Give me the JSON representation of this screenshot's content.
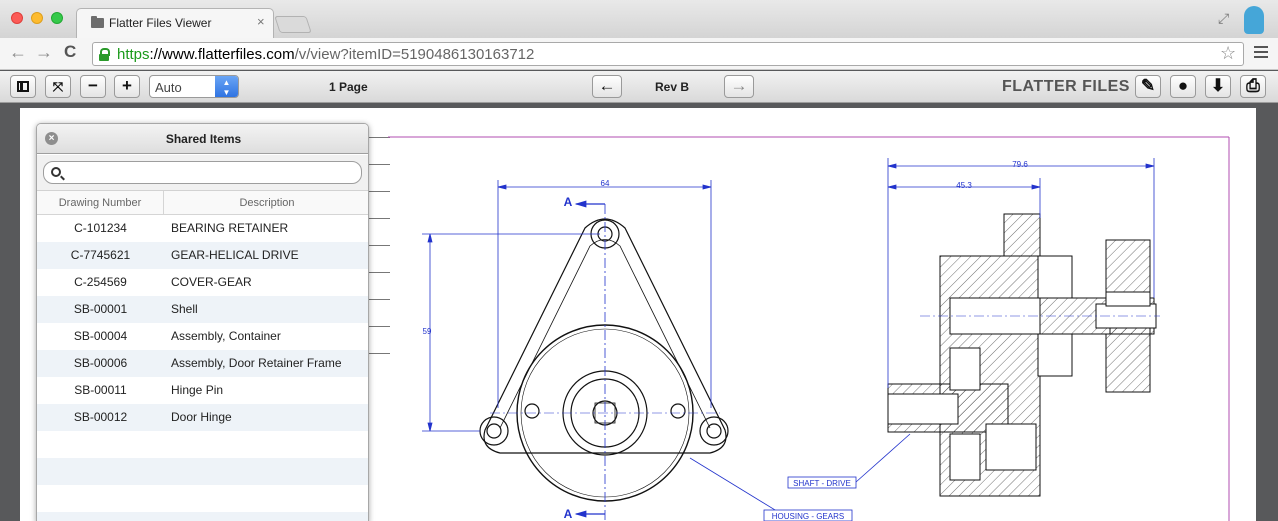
{
  "browser": {
    "tab_title": "Flatter Files Viewer",
    "tab_close": "×",
    "url_scheme": "https",
    "url_sep": "://",
    "url_host": "www.flatterfiles.com",
    "url_path": "/v/view?itemID=5190486130163712",
    "back_glyph": "←",
    "forward_glyph": "→",
    "reload_glyph": "C",
    "star_glyph": "☆",
    "expand_glyph": "⤢"
  },
  "toolbar": {
    "fit_glyph": "⤧",
    "zoom_out": "−",
    "zoom_in": "+",
    "zoom_value": "Auto",
    "page_count": "1 Page",
    "prev_rev": "←",
    "revision": "Rev B",
    "next_rev": "→",
    "brand": "FLATTER FILES",
    "edit_glyph": "✎",
    "tip_glyph": "●",
    "download_glyph": "⬇",
    "print_glyph": "⎙"
  },
  "panel": {
    "title": "Shared Items",
    "close_glyph": "×",
    "search_placeholder": "",
    "columns": [
      "Drawing Number",
      "Description"
    ],
    "rows": [
      {
        "number": "C-101234",
        "description": "BEARING RETAINER"
      },
      {
        "number": "C-7745621",
        "description": "GEAR-HELICAL DRIVE"
      },
      {
        "number": "C-254569",
        "description": "COVER-GEAR"
      },
      {
        "number": "SB-00001",
        "description": "Shell"
      },
      {
        "number": "SB-00004",
        "description": "Assembly, Container"
      },
      {
        "number": "SB-00006",
        "description": "Assembly, Door Retainer Frame"
      },
      {
        "number": "SB-00011",
        "description": "Hinge Pin"
      },
      {
        "number": "SB-00012",
        "description": "Door Hinge"
      }
    ]
  },
  "drawing": {
    "section_label": "A",
    "dim_width": "64",
    "dim_height": "59",
    "dim_overall": "79.6",
    "dim_partial": "45.3",
    "callout_shaft": "SHAFT - DRIVE",
    "callout_housing": "HOUSING - GEARS"
  },
  "colors": {
    "dimension": "#2233cc",
    "border": "#b04db0",
    "accent": "#2a6fe0"
  }
}
